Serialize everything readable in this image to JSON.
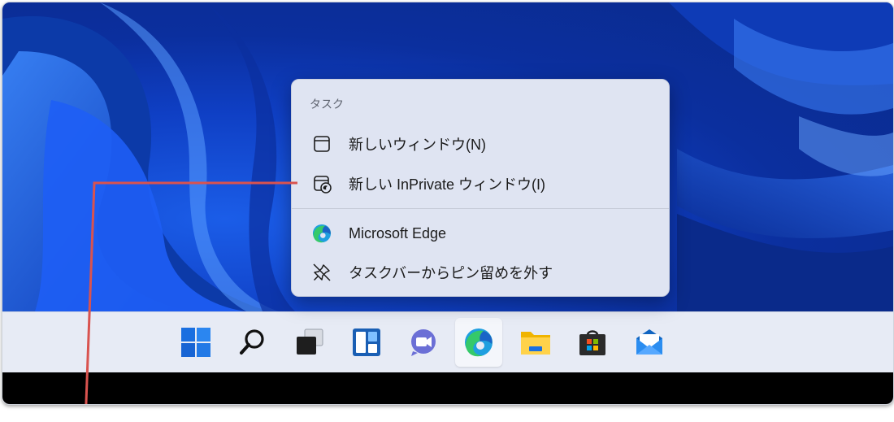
{
  "jump_list": {
    "header": "タスク",
    "items": [
      {
        "label": "新しいウィンドウ(N)",
        "icon": "window-icon"
      },
      {
        "label": "新しい InPrivate ウィンドウ(I)",
        "icon": "inprivate-window-icon"
      },
      {
        "label": "Microsoft Edge",
        "icon": "edge-icon"
      },
      {
        "label": "タスクバーからピン留めを外す",
        "icon": "unpin-icon"
      }
    ]
  },
  "taskbar": {
    "icons": [
      {
        "name": "start-icon"
      },
      {
        "name": "search-icon"
      },
      {
        "name": "task-view-icon"
      },
      {
        "name": "widgets-icon"
      },
      {
        "name": "teams-chat-icon"
      },
      {
        "name": "edge-icon",
        "active": true
      },
      {
        "name": "file-explorer-icon"
      },
      {
        "name": "microsoft-store-icon"
      },
      {
        "name": "mail-icon"
      }
    ]
  },
  "colors": {
    "callout_line": "#d9534f",
    "menu_bg": "#dfe4f2",
    "taskbar_bg": "#e7ebf5",
    "accent": "#1a73e8"
  }
}
